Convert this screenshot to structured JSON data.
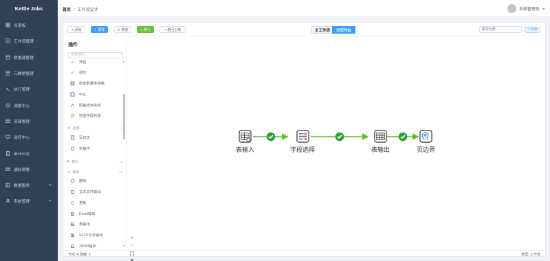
{
  "app": {
    "title": "Kettle Jobs"
  },
  "sidebar": {
    "items": [
      {
        "label": "仪表板",
        "icon": "dashboard-icon",
        "has_children": false
      },
      {
        "label": "工作流管理",
        "icon": "workflow-icon",
        "has_children": false
      },
      {
        "label": "数据源管理",
        "icon": "database-icon",
        "has_children": false
      },
      {
        "label": "元数据管理",
        "icon": "metadata-icon",
        "has_children": false
      },
      {
        "label": "执行管理",
        "icon": "execution-icon",
        "has_children": false
      },
      {
        "label": "调度中心",
        "icon": "clock-icon",
        "has_children": false
      },
      {
        "label": "资源管理",
        "icon": "resource-icon",
        "has_children": false
      },
      {
        "label": "监控中心",
        "icon": "monitor-icon",
        "has_children": false
      },
      {
        "label": "审计日志",
        "icon": "audit-log-icon",
        "has_children": false
      },
      {
        "label": "通知预警",
        "icon": "bell-icon",
        "has_children": false
      },
      {
        "label": "数据服务",
        "icon": "data-service-icon",
        "has_children": true
      },
      {
        "label": "系统管理",
        "icon": "settings-icon",
        "has_children": true
      }
    ]
  },
  "header": {
    "breadcrumb": [
      "首页",
      "工作流设计"
    ],
    "separator": "/",
    "user_name": "系统管理员"
  },
  "toolbar": {
    "add": "+ 添加",
    "save": "✓ 保存",
    "preview": "⟲ 预览",
    "run": "▷ 执行",
    "back": "+ 返回上级",
    "mode_main": "主工作流",
    "mode_paging": "分页作业",
    "exec_input_value": "执行分页",
    "tag": "工作流"
  },
  "plugins": {
    "title": "插件",
    "search_placeholder": "搜索插件...",
    "items_top": [
      {
        "label": "开始",
        "icon": "check-icon"
      },
      {
        "label": "成功",
        "icon": "check-icon"
      },
      {
        "label": "检查数据库连接",
        "icon": "db-check-icon"
      },
      {
        "label": "中止",
        "icon": "stop-square-icon"
      },
      {
        "label": "阻塞直到完成",
        "icon": "block-icon"
      },
      {
        "label": "检验字段的值",
        "icon": "validate-icon"
      }
    ],
    "group_apply": {
      "label": "应用",
      "count": "2"
    },
    "items_apply": [
      {
        "label": "写日志",
        "icon": "write-log-icon"
      },
      {
        "label": "空操作",
        "icon": "noop-icon"
      }
    ],
    "group_input": {
      "label": "输入",
      "count": "11"
    },
    "group_output": {
      "label": "输出",
      "count": "10"
    },
    "items_output": [
      {
        "label": "删除",
        "icon": "delete-icon"
      },
      {
        "label": "文本文件输出",
        "icon": "text-file-icon"
      },
      {
        "label": "更新",
        "icon": "refresh-icon"
      },
      {
        "label": "Excel输出",
        "icon": "excel-icon"
      },
      {
        "label": "表输出",
        "icon": "table-output-icon"
      },
      {
        "label": "SFTP文件输出",
        "icon": "sftp-icon"
      },
      {
        "label": "JSON输出",
        "icon": "json-icon"
      }
    ]
  },
  "flow": {
    "nodes": [
      {
        "label": "表输入",
        "icon": "table-input-icon"
      },
      {
        "label": "字段选择",
        "icon": "field-select-icon"
      },
      {
        "label": "表输出",
        "icon": "table-output-icon"
      },
      {
        "label": "页边界",
        "icon": "page-boundary-icon"
      }
    ],
    "edge_color": "#52c41a"
  },
  "zoom": {
    "in": "+",
    "out": "−",
    "fit": "⛶",
    "lock": "🔒"
  },
  "status": {
    "left": "节点: 4    连接: 3",
    "right": "类型: 工作流"
  },
  "colors": {
    "sidebar": "#304156",
    "primary": "#409eff",
    "success": "#67c23a",
    "edge": "#52c41a"
  }
}
